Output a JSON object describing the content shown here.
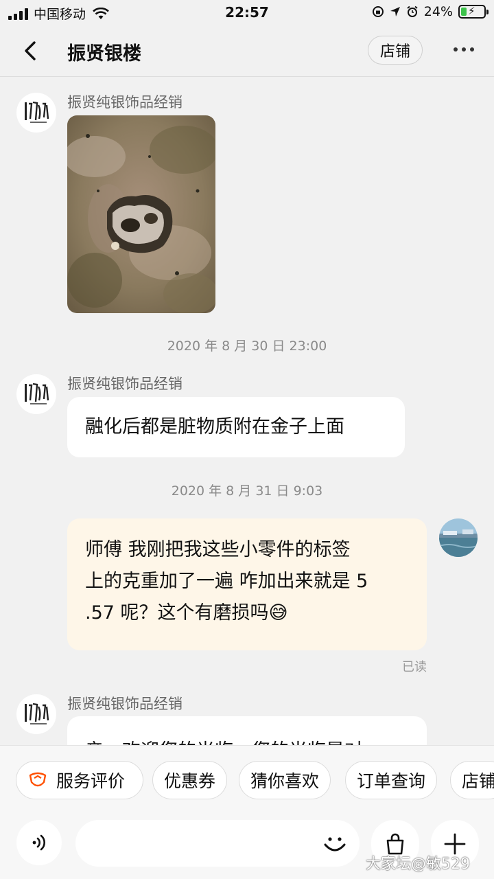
{
  "status_bar": {
    "carrier": "中国移动",
    "time": "22:57",
    "battery_percent": "24%",
    "battery_level": 0.24
  },
  "header": {
    "title": "振贤银楼",
    "shop_button": "店铺"
  },
  "messages": {
    "m1_sender": "振贤纯银饰品经销",
    "ts1": "2020 年 8 月 30 日 23:00",
    "m2_sender": "振贤纯银饰品经销",
    "m2_text": "融化后都是脏物质附在金子上面",
    "ts2": "2020 年 8 月 31 日 9:03",
    "m3_line1": "师傅 我刚把我这些小零件的标签",
    "m3_line2": "上的克重加了一遍 咋加出来就是 5",
    "m3_line3": ".57 呢？这个有磨损吗",
    "m3_emoji": "😅",
    "m3_status": "已读",
    "m4_sender": "振贤纯银饰品经销",
    "m4_partial": "亲，欢迎您的光临，您的光临是对"
  },
  "quick_actions": {
    "service_review": "服务评价",
    "coupon": "优惠券",
    "guess": "猜你喜欢",
    "order_query": "订单查询",
    "shop": "店铺"
  },
  "watermark": "大家坛@敏529",
  "colors": {
    "accent": "#ff5000",
    "out_bubble": "#fef6e8"
  },
  "icons": [
    "back-icon",
    "more-icon",
    "voice-icon",
    "emoji-icon",
    "bag-icon",
    "plus-icon",
    "service-review-icon"
  ]
}
